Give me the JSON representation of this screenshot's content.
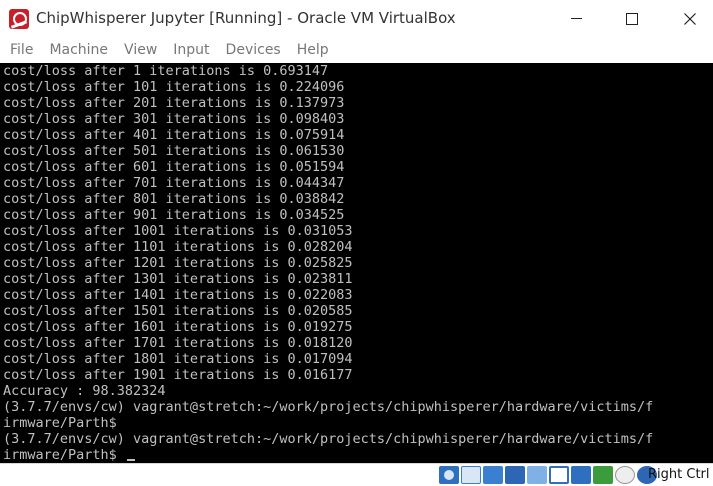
{
  "window": {
    "title": "ChipWhisperer Jupyter [Running] - Oracle VM VirtualBox",
    "controls": {
      "minimize": "minimize-icon",
      "maximize": "maximize-icon",
      "close": "close-icon"
    }
  },
  "menu": {
    "items": [
      "File",
      "Machine",
      "View",
      "Input",
      "Devices",
      "Help"
    ]
  },
  "terminal": {
    "lines": [
      "cost/loss after 1 iterations is 0.693147",
      "cost/loss after 101 iterations is 0.224096",
      "cost/loss after 201 iterations is 0.137973",
      "cost/loss after 301 iterations is 0.098403",
      "cost/loss after 401 iterations is 0.075914",
      "cost/loss after 501 iterations is 0.061530",
      "cost/loss after 601 iterations is 0.051594",
      "cost/loss after 701 iterations is 0.044347",
      "cost/loss after 801 iterations is 0.038842",
      "cost/loss after 901 iterations is 0.034525",
      "cost/loss after 1001 iterations is 0.031053",
      "cost/loss after 1101 iterations is 0.028204",
      "cost/loss after 1201 iterations is 0.025825",
      "cost/loss after 1301 iterations is 0.023811",
      "cost/loss after 1401 iterations is 0.022083",
      "cost/loss after 1501 iterations is 0.020585",
      "cost/loss after 1601 iterations is 0.019275",
      "cost/loss after 1701 iterations is 0.018120",
      "cost/loss after 1801 iterations is 0.017094",
      "cost/loss after 1901 iterations is 0.016177",
      "Accuracy : 98.382324",
      "(3.7.7/envs/cw) vagrant@stretch:~/work/projects/chipwhisperer/hardware/victims/f",
      "irmware/Parth$",
      "(3.7.7/envs/cw) vagrant@stretch:~/work/projects/chipwhisperer/hardware/victims/f",
      "irmware/Parth$ "
    ]
  },
  "statusbar": {
    "icons": [
      "hard-disk-icon",
      "optical-drive-icon",
      "network-icon",
      "usb-icon",
      "shared-folder-icon",
      "display-icon",
      "video-capture-icon",
      "vt-x-icon",
      "mouse-integration-icon",
      "keyboard-capture-icon"
    ],
    "host_key": "Right Ctrl"
  },
  "colors": {
    "terminal_bg": "#000000",
    "terminal_fg": "#c0c0c0",
    "icon_red": "#c8202a"
  }
}
